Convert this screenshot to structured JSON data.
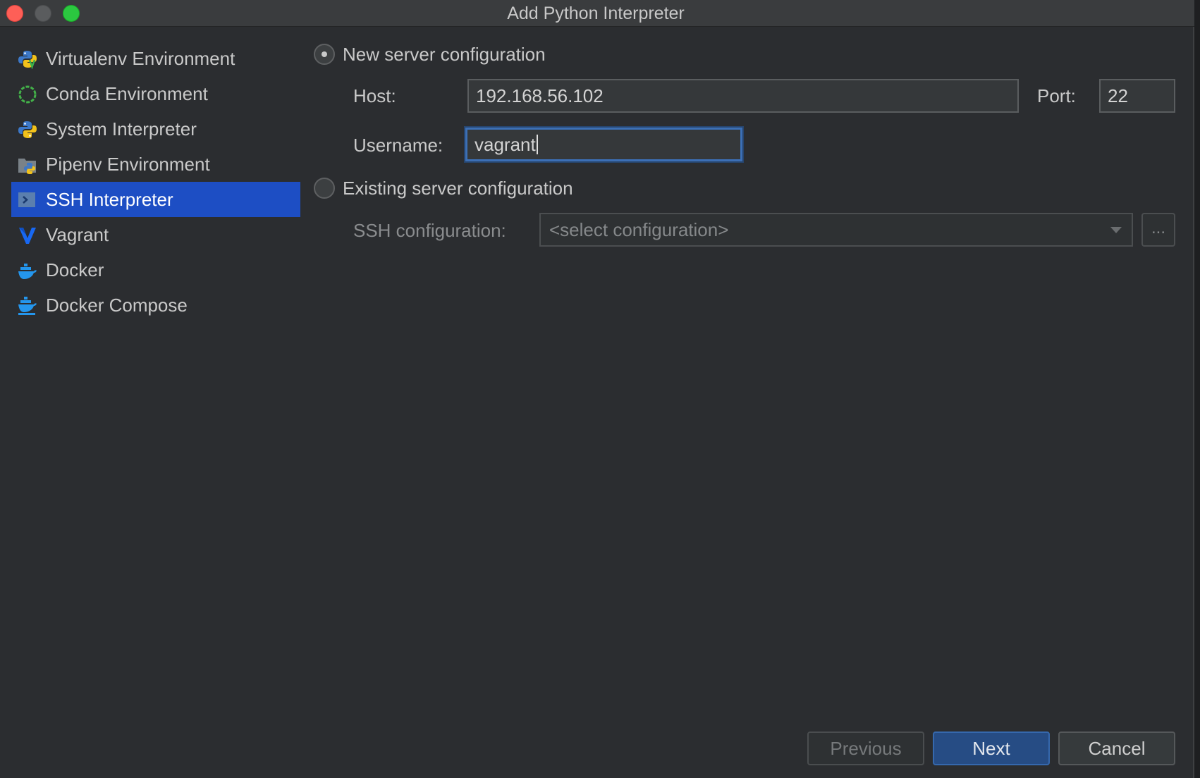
{
  "window": {
    "title": "Add Python Interpreter"
  },
  "sidebar": {
    "items": [
      {
        "label": "Virtualenv Environment",
        "icon": "python-venv-icon"
      },
      {
        "label": "Conda Environment",
        "icon": "conda-icon"
      },
      {
        "label": "System Interpreter",
        "icon": "python-icon"
      },
      {
        "label": "Pipenv Environment",
        "icon": "pipenv-icon"
      },
      {
        "label": "SSH Interpreter",
        "icon": "ssh-terminal-icon",
        "selected": true
      },
      {
        "label": "Vagrant",
        "icon": "vagrant-icon"
      },
      {
        "label": "Docker",
        "icon": "docker-icon"
      },
      {
        "label": "Docker Compose",
        "icon": "docker-compose-icon"
      }
    ]
  },
  "new_server": {
    "radio_label": "New server configuration",
    "selected": true,
    "host_label": "Host:",
    "host_value": "192.168.56.102",
    "port_label": "Port:",
    "port_value": "22",
    "username_label": "Username:",
    "username_value": "vagrant"
  },
  "existing_server": {
    "radio_label": "Existing server configuration",
    "selected": false,
    "ssh_config_label": "SSH configuration:",
    "ssh_config_placeholder": "<select configuration>",
    "browse_label": "..."
  },
  "buttons": {
    "previous": "Previous",
    "next": "Next",
    "cancel": "Cancel"
  },
  "colors": {
    "background": "#2b2d30",
    "selection": "#1d4ec4",
    "primary_button": "#264c84",
    "focus_ring": "#3c6fb5"
  }
}
